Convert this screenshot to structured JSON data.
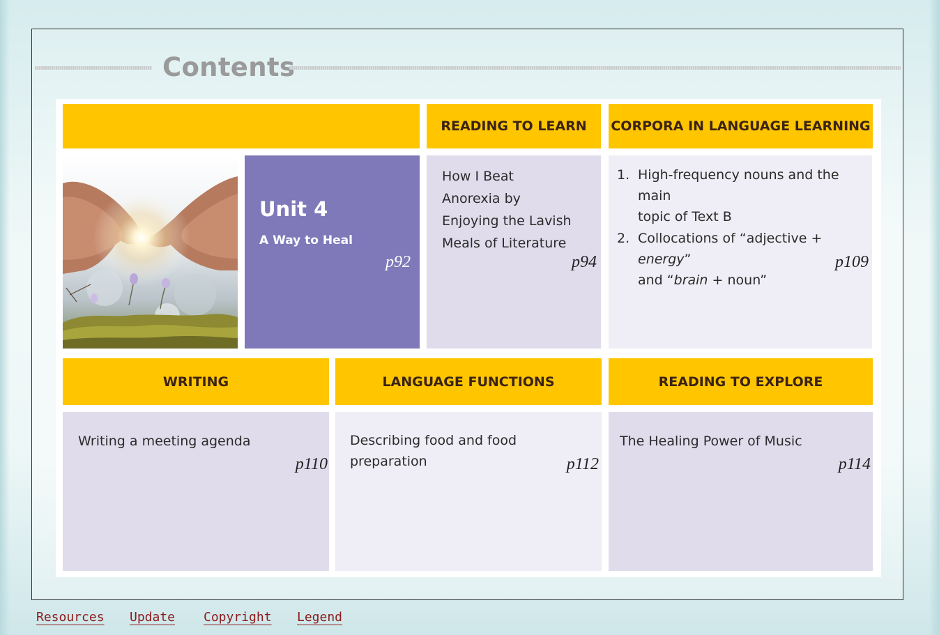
{
  "page": {
    "title": "Contents"
  },
  "unit": {
    "number_label": "Unit 4",
    "subtitle": "A Way to Heal",
    "page": "p92"
  },
  "sections": {
    "reading_to_learn": {
      "header": "READING TO LEARN",
      "text": "How I Beat Anorexia by Enjoying the Lavish Meals of Literature",
      "lines": [
        "How I Beat",
        "Anorexia by",
        "Enjoying the Lavish",
        "Meals of Literature"
      ],
      "page": "p94"
    },
    "corpora": {
      "header": "CORPORA IN LANGUAGE LEARNING",
      "items": [
        {
          "num": "1.",
          "line1": "High-frequency nouns and the main",
          "line2": "topic of Text B"
        },
        {
          "num": "2.",
          "line1_prefix": "Collocations of “adjective + ",
          "line1_italic": "energy",
          "line1_suffix": "”",
          "line2_prefix": "and “",
          "line2_italic": "brain",
          "line2_suffix": " + noun”"
        }
      ],
      "page": "p109"
    },
    "writing": {
      "header": "WRITING",
      "text": "Writing a meeting agenda",
      "page": "p110"
    },
    "language_functions": {
      "header": "LANGUAGE FUNCTIONS",
      "line1": "Describing food and food",
      "line2": "preparation",
      "page": "p112"
    },
    "reading_to_explore": {
      "header": "READING TO EXPLORE",
      "text": "The Healing Power of Music",
      "page": "p114"
    }
  },
  "nav": {
    "resources": "Resources",
    "update": "Update",
    "copyright": "Copyright",
    "legend": "Legend"
  },
  "colors": {
    "header_yellow": "#ffc600",
    "unit_purple": "#7f79b9",
    "cell_lavender": "#e0dcec",
    "cell_pale": "#efedf5",
    "nav_link": "#8b1a1a",
    "title_gray": "#9a9a9a"
  },
  "icons": {
    "unit_image": "hands-sunlight-photo"
  }
}
